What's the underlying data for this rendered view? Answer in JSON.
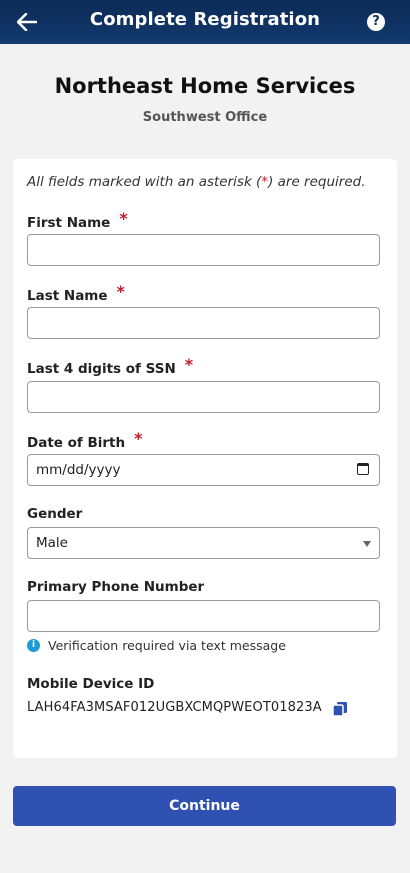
{
  "header": {
    "title": "Complete Registration",
    "back_icon": "arrow-left-icon",
    "help_label": "?",
    "help_icon": "question-circle-icon",
    "background": "#0e2f5e"
  },
  "org": {
    "name": "Northeast Home Services",
    "office": "Southwest Office"
  },
  "form": {
    "note_prefix": "All fields marked with an asterisk (",
    "note_star": "*",
    "note_suffix": ") are required.",
    "required_marker": "*",
    "fields": {
      "first_name": {
        "label": "First Name",
        "value": ""
      },
      "last_name": {
        "label": "Last Name",
        "value": ""
      },
      "ssn": {
        "label": "Last 4 digits of SSN",
        "value": ""
      },
      "dob": {
        "label": "Date of Birth",
        "value": "mm/dd/yyyy"
      },
      "gender": {
        "label": "Gender",
        "value": "Male"
      },
      "phone": {
        "label": "Primary Phone Number",
        "value": ""
      }
    },
    "phone_hint": "Verification required via text message",
    "info_icon": "info-circle-icon",
    "device": {
      "label": "Mobile Device ID",
      "value": "LAH64FA3MSAF012UGBXCMQPWEOT01823A",
      "copy_icon": "copy-icon"
    }
  },
  "actions": {
    "continue_label": "Continue",
    "accent": "#2f51b1"
  }
}
